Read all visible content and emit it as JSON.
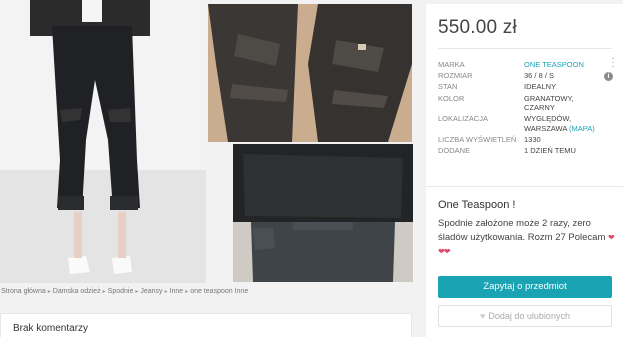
{
  "listing": {
    "price": "550.00 zł",
    "attributes": [
      {
        "label": "Marka",
        "value": "One Teaspoon",
        "link": true
      },
      {
        "label": "Rozmiar",
        "value": "36 / 8 / S"
      },
      {
        "label": "Stan",
        "value": "Idealny"
      },
      {
        "label": "Kolor",
        "value": "Granatowy,\nczarny"
      },
      {
        "label": "Lokalizacja",
        "value": "Wyględów,\nWarszawa",
        "map": "(MAPA)"
      },
      {
        "label": "Liczba wyświetleń",
        "value": "1330"
      },
      {
        "label": "Dodane",
        "value": "1 dzień temu"
      }
    ],
    "title": "One Teaspoon !",
    "description": "Spodnie założone może 2 razy, zero śladów użytkowania. Rozm 27 Polecam",
    "hearts": "❤❤❤",
    "ask_button": "Zapytaj o przedmiot",
    "fav_button": "Dodaj do ulubionych"
  },
  "breadcrumb": [
    "Strona główna",
    "Damska odzież",
    "Spodnie",
    "Jeansy",
    "Inne",
    "one teaspoon Inne"
  ],
  "comments": {
    "title": "Brak komentarzy"
  },
  "colors": {
    "accent": "#1aa3b3",
    "hearts": "#e04a6b"
  },
  "icons": {
    "more": "more-vertical-icon",
    "info": "info-icon",
    "favorite": "heart-icon",
    "breadcrumb_sep": "caret-right-icon"
  }
}
